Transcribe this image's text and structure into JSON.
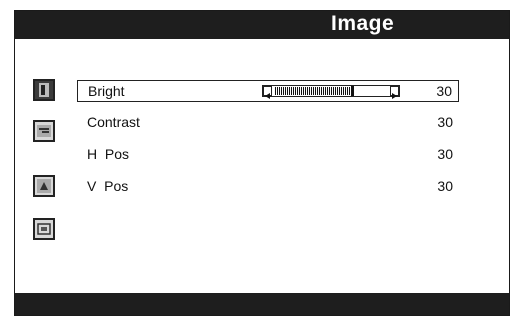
{
  "title": "Image",
  "icons": [
    "brightness-menu-icon",
    "picture-adjust-icon",
    "position-menu-icon",
    "display-setup-icon"
  ],
  "items": [
    {
      "label": "Bright",
      "value": "30",
      "selected": true,
      "slider_fraction": 0.68
    },
    {
      "label": "Contrast",
      "value": "30"
    },
    {
      "label": "H  Pos",
      "value": "30"
    },
    {
      "label": "V  Pos",
      "value": "30"
    }
  ]
}
